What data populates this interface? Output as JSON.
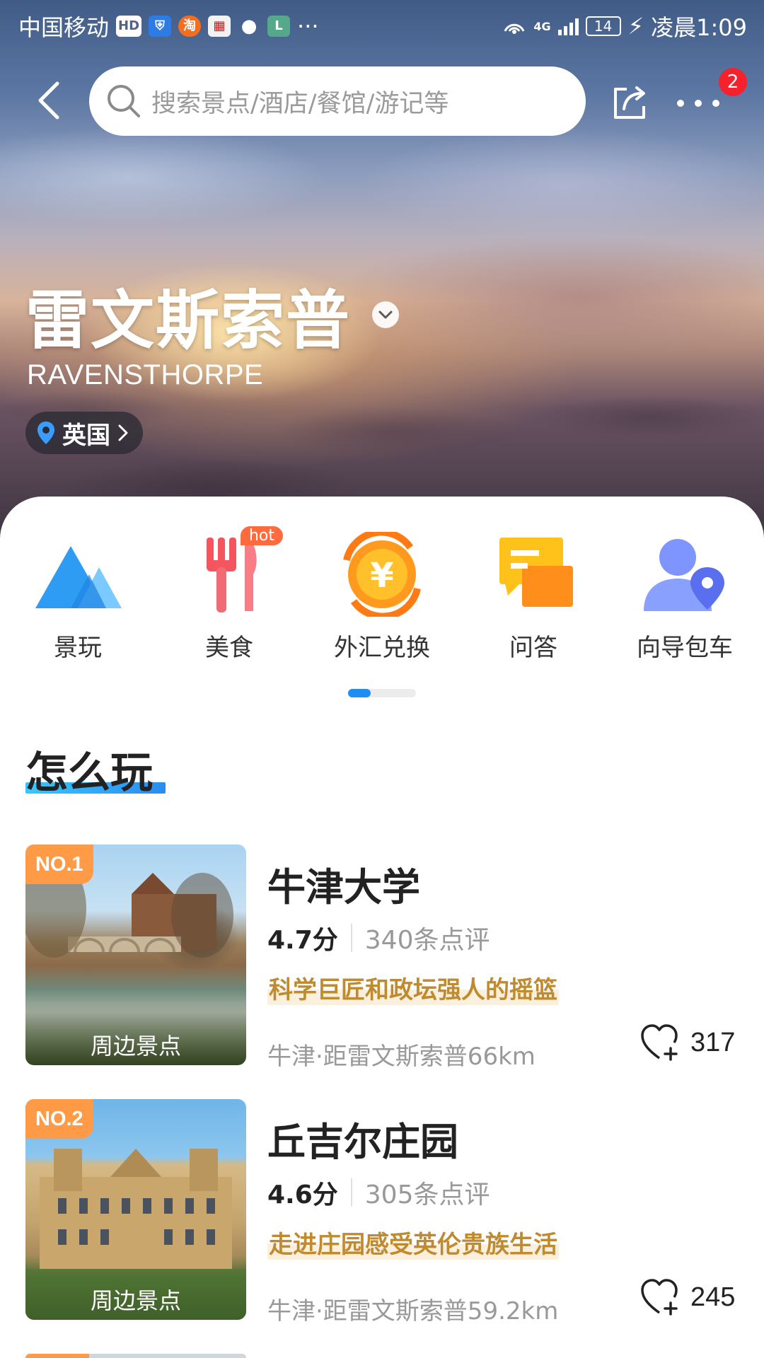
{
  "status_bar": {
    "carrier": "中国移动",
    "badge_hd": "HD",
    "overflow": "···",
    "network": "4G",
    "battery": "14",
    "time": "凌晨1:09"
  },
  "nav": {
    "search_placeholder": "搜索景点/酒店/餐馆/游记等",
    "more_badge": "2"
  },
  "hero": {
    "title": "雷文斯索普",
    "title_en": "RAVENSTHORPE",
    "country": "英国"
  },
  "categories": [
    {
      "label": "景玩",
      "icon": "mountain-icon"
    },
    {
      "label": "美食",
      "icon": "fork-knife-icon",
      "tag": "hot"
    },
    {
      "label": "外汇兑换",
      "icon": "currency-exchange-icon"
    },
    {
      "label": "问答",
      "icon": "chat-bubbles-icon"
    },
    {
      "label": "向导包车",
      "icon": "guide-location-icon"
    }
  ],
  "carousel": {
    "page": 1,
    "pages": 3
  },
  "section": {
    "title": "怎么玩"
  },
  "pois": [
    {
      "rank": "NO.1",
      "tag": "周边景点",
      "name": "牛津大学",
      "score": "4.7分",
      "reviews": "340条点评",
      "slogan": "科学巨匠和政坛强人的摇篮",
      "distance": "牛津·距雷文斯索普66km",
      "favorites": "317"
    },
    {
      "rank": "NO.2",
      "tag": "周边景点",
      "name": "丘吉尔庄园",
      "score": "4.6分",
      "reviews": "305条点评",
      "slogan": "走进庄园感受英伦贵族生活",
      "distance": "牛津·距雷文斯索普59.2km",
      "favorites": "245"
    }
  ],
  "colors": {
    "accent": "#1c8ef5",
    "rank_badge": "#ff9a47",
    "slogan": "#c08a2e",
    "notification": "#f5222d"
  }
}
